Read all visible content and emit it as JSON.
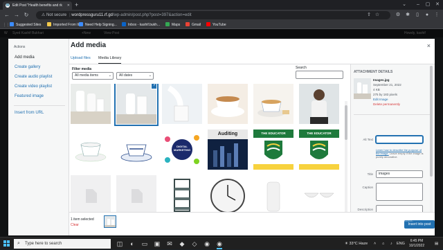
{
  "browser": {
    "tab_title": "Edit Post \"Health benefits and rk",
    "not_secure": "Not secure",
    "url_host": "wordpressguru11.rf.gd",
    "url_path": "/wp-admin/post.php?post=397&action=edit",
    "bookmarks": [
      {
        "label": "Suggested Sites",
        "color": "#3c8cff"
      },
      {
        "label": "Imported From IE",
        "color": "#f2c94c"
      },
      {
        "label": "Need Help Signing...",
        "color": "#3c8cff"
      },
      {
        "label": "Inbox - kashif.bukh...",
        "color": "#ea4335"
      },
      {
        "label": "Maps",
        "color": "#34a853"
      },
      {
        "label": "Gmail",
        "color": "#ea4335"
      },
      {
        "label": "YouTube",
        "color": "#ff0000"
      }
    ]
  },
  "admin_bar": {
    "site": "Syed Kashif Bukhari",
    "new": "New",
    "view": "View Post",
    "howdy": "Howdy, kashif"
  },
  "modal": {
    "actions_heading": "Actions",
    "menu": [
      "Add media",
      "Create gallery",
      "Create audio playlist",
      "Create video playlist",
      "Featured image",
      "Insert from URL"
    ],
    "title": "Add media",
    "close": "×",
    "routers": [
      "Upload files",
      "Media Library"
    ],
    "filter_label": "Filter media",
    "filter_type": "All media items",
    "filter_date": "All dates",
    "search_label": "Search",
    "search_value": ""
  },
  "grid_labels": {
    "digital": "DIGITAL MARKETING",
    "auditing": "Auditing",
    "educator": "THE EDUCATOR"
  },
  "details": {
    "heading": "Attachment Details",
    "filename": "Images.jpg",
    "date": "September 21, 2022",
    "size": "4 KB",
    "dimensions": "275 by 183 pixels",
    "edit": "Edit Image",
    "delete": "Delete permanently",
    "alt_label": "Alt Text",
    "alt_value": "",
    "help_link": "Learn how to describe the purpose of the image.",
    "help_rest": " Leave empty if the image is purely decorative.",
    "title_label": "Title",
    "title_value": "images",
    "caption_label": "Caption",
    "description_label": "Description"
  },
  "toolbar": {
    "selected": "1 item selected",
    "clear": "Clear",
    "insert": "Insert into post"
  },
  "watermark": {
    "line1": "Activate Windows",
    "line2": "Go to Settings to activate Windows."
  },
  "taskbar": {
    "search": "Type here to search",
    "weather": "33°C  Haze",
    "lang": "ENG",
    "time": "6:45 PM",
    "date": "10/1/2022"
  },
  "colors": {
    "accent": "#2271b1",
    "danger": "#d63638"
  }
}
